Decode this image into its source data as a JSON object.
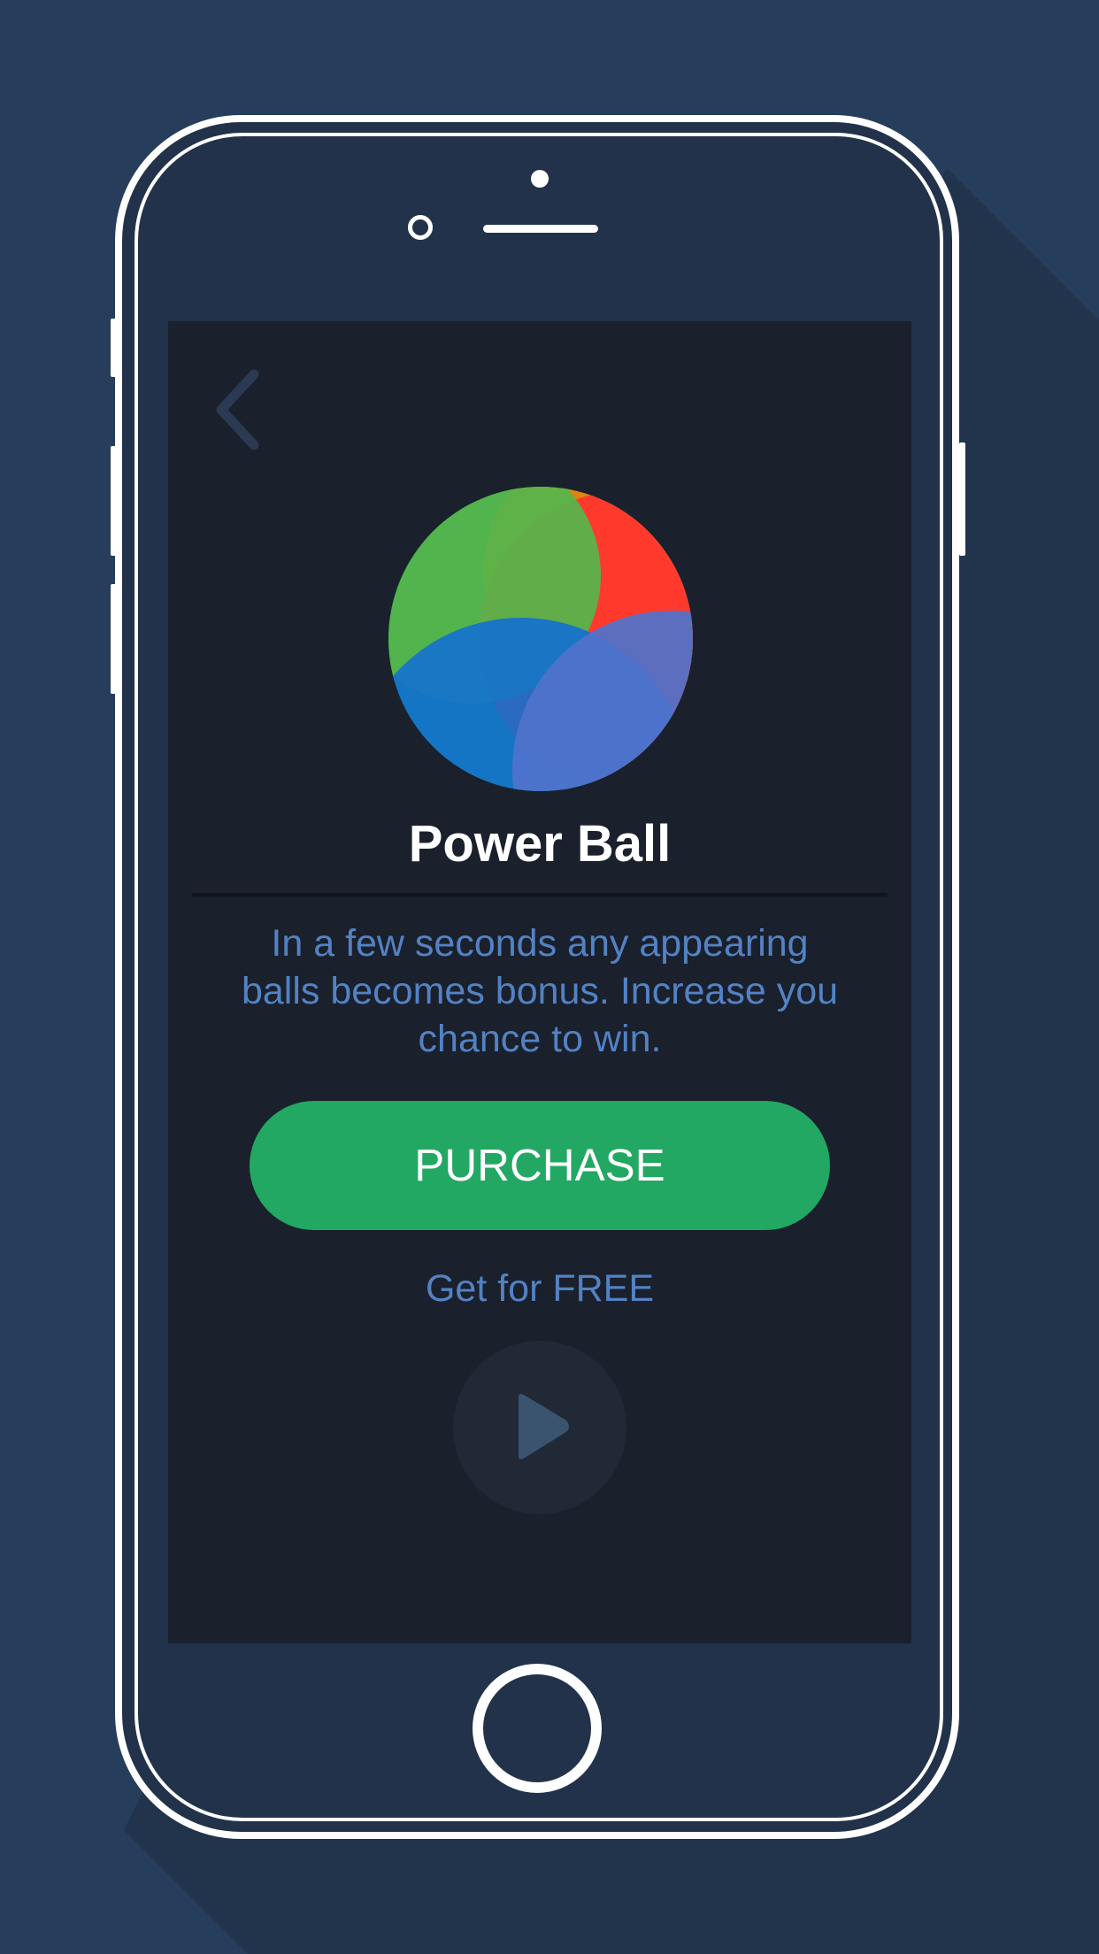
{
  "product": {
    "title": "Power Ball",
    "description": "In a few seconds any appearing balls becomes bonus. Increase you chance to win."
  },
  "actions": {
    "purchase_label": "PURCHASE",
    "free_label": "Get for FREE"
  },
  "icons": {
    "back": "chevron-left-icon",
    "ball": "power-ball-icon",
    "play": "play-icon"
  },
  "colors": {
    "background": "#263d5b",
    "screen": "#1a202c",
    "accent_green": "#22a862",
    "text_blue": "#5382c4",
    "ball_green": "#55b64b",
    "ball_orange": "#e0820f",
    "ball_red": "#ff3a2c",
    "ball_blue": "#1370d1",
    "ball_periwinkle": "#5073cc"
  }
}
